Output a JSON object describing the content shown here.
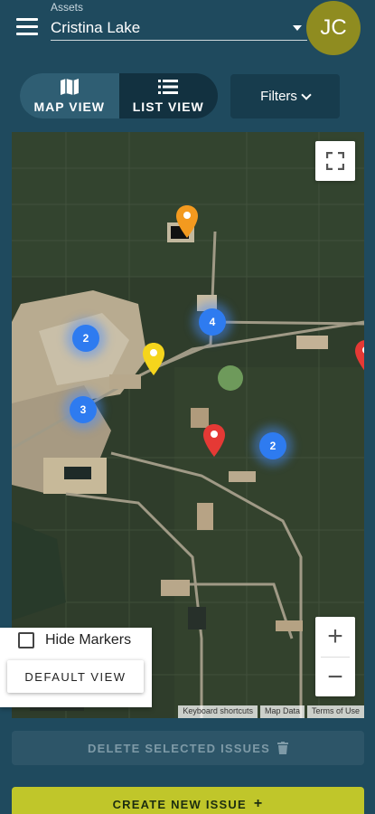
{
  "header": {
    "asset_label": "Assets",
    "asset_value": "Cristina Lake",
    "avatar_initials": "JC"
  },
  "view_toggle": {
    "map_label": "MAP VIEW",
    "list_label": "LIST VIEW",
    "active": "map"
  },
  "filters_label": "Filters",
  "map": {
    "clusters": [
      "2",
      "4",
      "3",
      "2"
    ],
    "marker_colors": {
      "orange": "#f39a1f",
      "yellow": "#f5d51c",
      "red": "#e53935"
    },
    "attribution": {
      "keyboard": "Keyboard shortcuts",
      "map_data": "Map Data",
      "terms": "Terms of Use"
    }
  },
  "hide_markers_label": "Hide Markers",
  "default_view_label": "DEFAULT VIEW",
  "delete_label": "DELETE SELECTED ISSUES",
  "create_label": "CREATE NEW ISSUE"
}
